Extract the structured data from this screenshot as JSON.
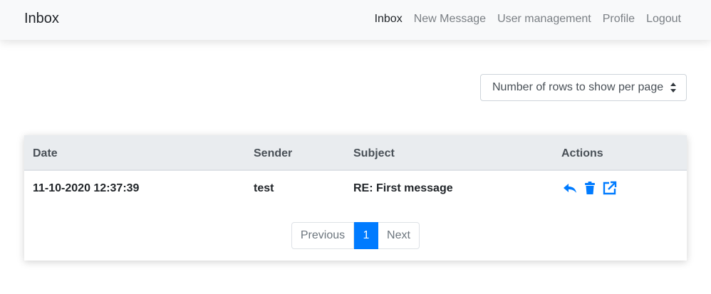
{
  "navbar": {
    "brand": "Inbox",
    "links": [
      {
        "label": "Inbox",
        "active": true
      },
      {
        "label": "New Message",
        "active": false
      },
      {
        "label": "User management",
        "active": false
      },
      {
        "label": "Profile",
        "active": false
      },
      {
        "label": "Logout",
        "active": false
      }
    ]
  },
  "rows_select": {
    "label": "Number of rows to show per page"
  },
  "table": {
    "headers": [
      "Date",
      "Sender",
      "Subject",
      "Actions"
    ],
    "rows": [
      {
        "date": "11-10-2020 12:37:39",
        "sender": "test",
        "subject": "RE: First message",
        "actions": [
          "reply-icon",
          "trash-icon",
          "open-external-icon"
        ]
      }
    ]
  },
  "pagination": {
    "previous": "Previous",
    "current": "1",
    "next": "Next"
  },
  "colors": {
    "accent": "#007bff",
    "header_bg": "#e9ecef",
    "navbar_bg": "#f8f9fa"
  }
}
